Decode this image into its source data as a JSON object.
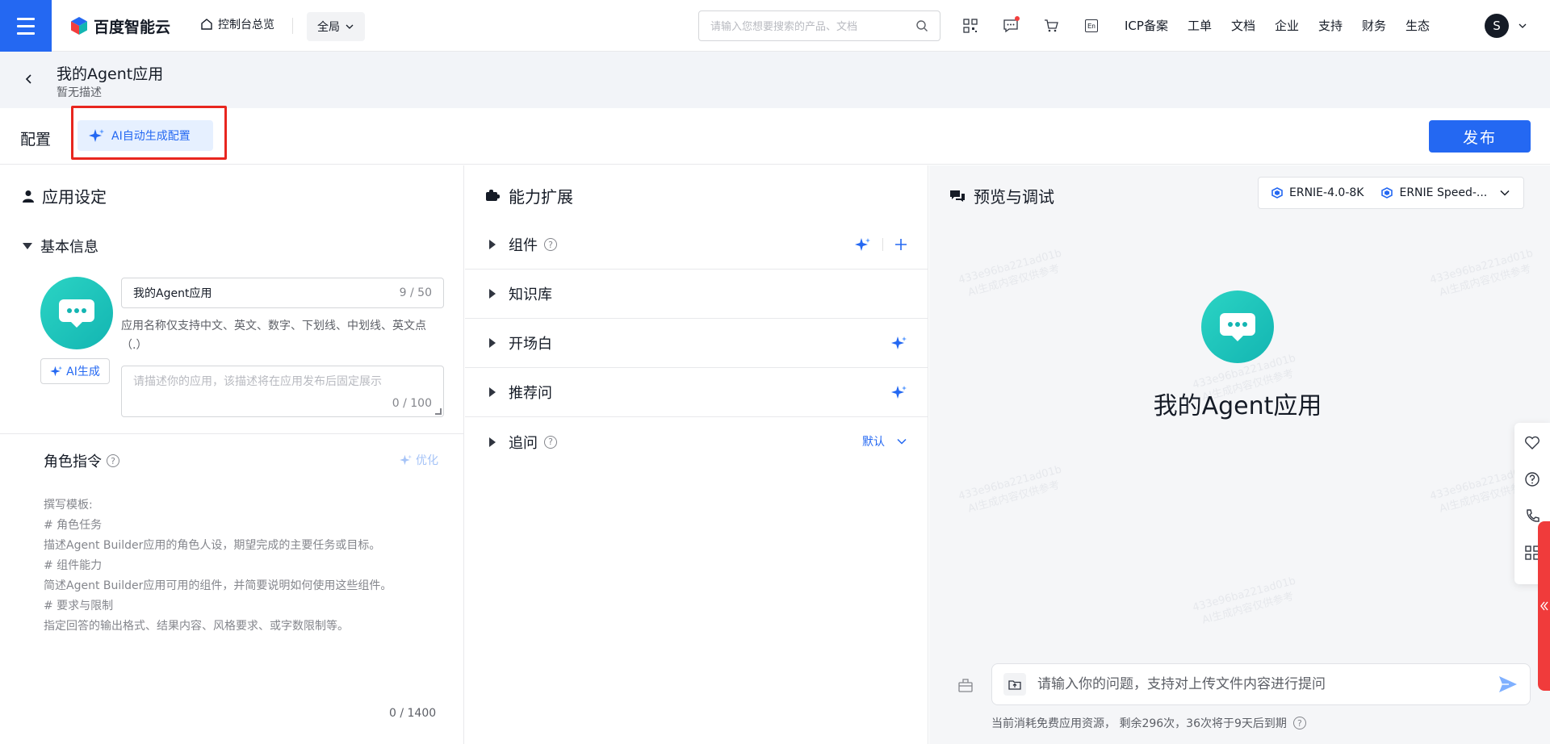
{
  "topbar": {
    "brand": "百度智能云",
    "home_link": "控制台总览",
    "region": "全局",
    "search_placeholder": "请输入您想要搜索的产品、文档",
    "lang_badge": "En",
    "links": [
      "ICP备案",
      "工单",
      "文档",
      "企业",
      "支持",
      "财务",
      "生态"
    ],
    "avatar_letter": "S"
  },
  "app": {
    "title": "我的Agent应用",
    "description": "暂无描述"
  },
  "configbar": {
    "label": "配置",
    "ai_generate": "AI自动生成配置",
    "publish": "发布"
  },
  "settings": {
    "title": "应用设定",
    "basic_info": "基本信息",
    "name_value": "我的Agent应用",
    "name_count": "9 / 50",
    "name_hint": "应用名称仅支持中文、英文、数字、下划线、中划线、英文点（.）",
    "ai_generate_small": "AI生成",
    "desc_placeholder": "请描述你的应用，该描述将在应用发布后固定展示",
    "desc_count": "0 / 100",
    "role_title": "角色指令",
    "optimize": "优化",
    "template_lines": [
      "撰写模板:",
      "# 角色任务",
      "描述Agent Builder应用的角色人设，期望完成的主要任务或目标。",
      "# 组件能力",
      "简述Agent Builder应用可用的组件，并简要说明如何使用这些组件。",
      "# 要求与限制",
      "指定回答的输出格式、结果内容、风格要求、或字数限制等。"
    ],
    "role_count": "0 / 1400"
  },
  "capabilities": {
    "title": "能力扩展",
    "rows": [
      {
        "label": "组件"
      },
      {
        "label": "知识库"
      },
      {
        "label": "开场白"
      },
      {
        "label": "推荐问"
      },
      {
        "label": "追问",
        "value": "默认"
      }
    ]
  },
  "preview": {
    "title": "预览与调试",
    "models": [
      "ERNIE-4.0-8K",
      "ERNIE Speed-..."
    ],
    "app_name": "我的Agent应用",
    "watermark_line1": "433e96ba221ad01b",
    "watermark_line2": "AI生成内容仅供参考",
    "input_placeholder": "请输入你的问题，支持对上传文件内容进行提问",
    "usage": "当前消耗免费应用资源， 剩余296次，36次将于9天后到期"
  },
  "colors": {
    "primary": "#2468f2",
    "highlight": "#e8261f",
    "avatar": "#13b5b2"
  }
}
